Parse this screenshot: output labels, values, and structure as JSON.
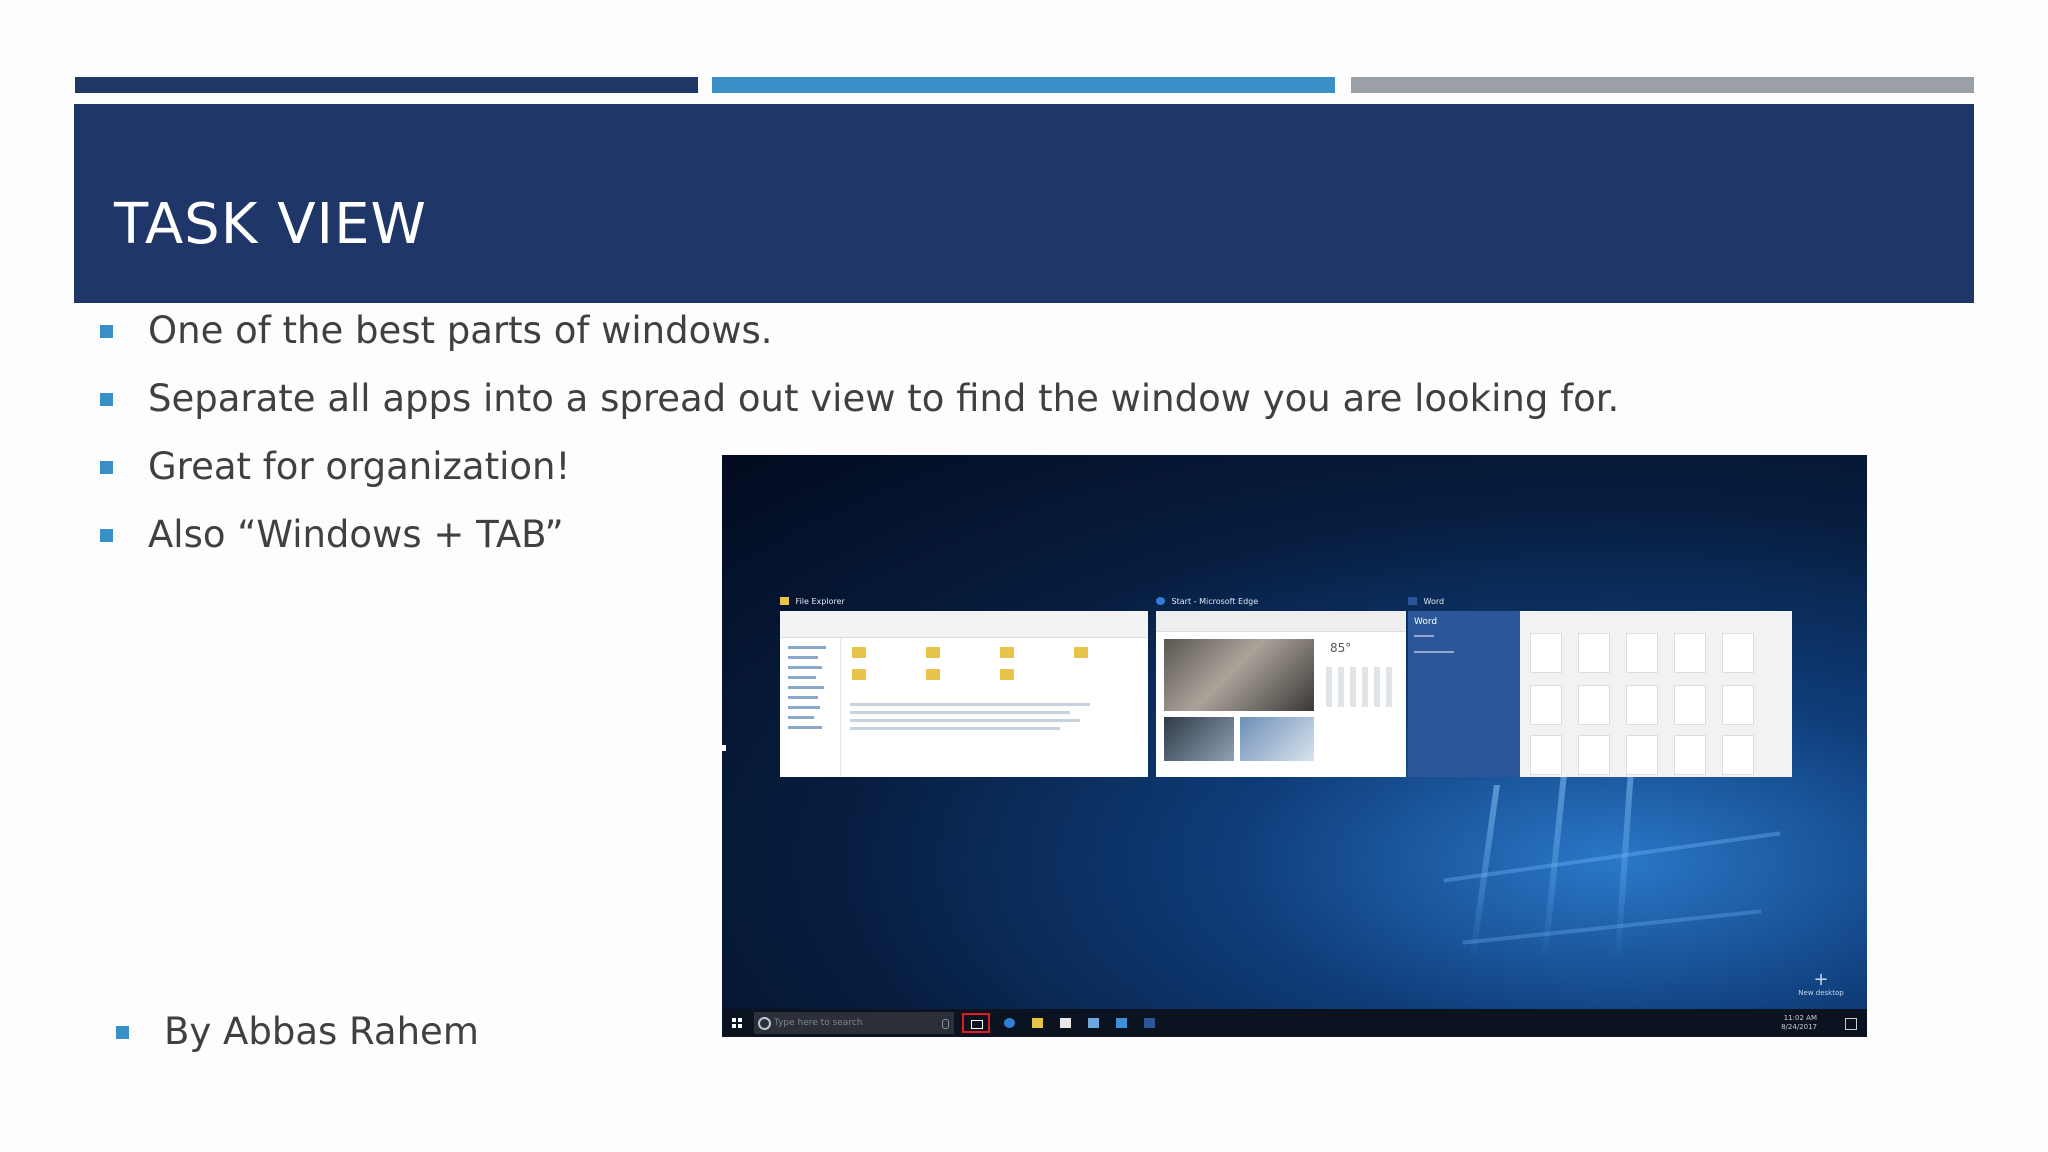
{
  "slide": {
    "title": "TASK VIEW",
    "bullets": [
      "One of the best parts of windows.",
      "Separate all apps into a spread out view to find the window you are looking for.",
      "Great for organization!",
      "Also “Windows + TAB”"
    ],
    "author": "By Abbas Rahem",
    "colors": {
      "title_band": "#1f3668",
      "bar_dark": "#1f3864",
      "bar_blue": "#3b8fc7",
      "bar_gray": "#9aa0a5",
      "bullet_marker": "#3b8fc7",
      "text": "#404040"
    }
  },
  "screenshot": {
    "windows": [
      {
        "caption": "File Explorer",
        "icon": "folder-icon"
      },
      {
        "caption": "Start - Microsoft Edge",
        "icon": "edge-icon"
      },
      {
        "caption": "Word",
        "icon": "word-icon"
      }
    ],
    "edge_temperature": "85°",
    "word_app_name": "Word",
    "taskbar": {
      "search_placeholder": "Type here to search",
      "highlighted": "task-view-button",
      "highlight_color": "#e01e1e",
      "pinned_icons": [
        "edge-icon",
        "file-explorer-icon",
        "store-icon",
        "network-icon",
        "photos-icon",
        "word-icon"
      ],
      "time": "11:02 AM",
      "date": "8/24/2017"
    },
    "new_desktop_label": "New desktop"
  }
}
